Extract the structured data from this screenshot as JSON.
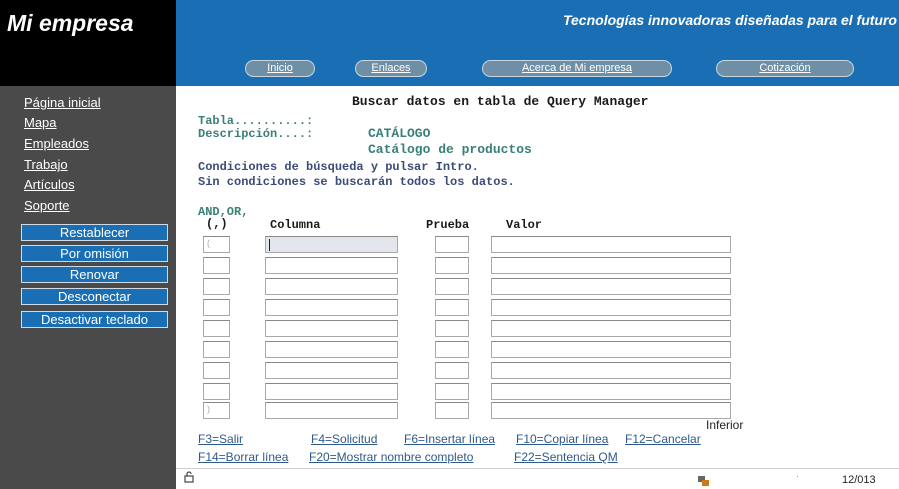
{
  "header": {
    "brand": "Mi empresa",
    "tagline": "Tecnologías innovadoras diseñadas para el futuro",
    "nav": [
      "Inicio",
      "Enlaces",
      "Acerca de Mi empresa",
      "Cotización"
    ]
  },
  "sidebar": {
    "links": [
      "Página inicial",
      "Mapa",
      "Empleados",
      "Trabajo",
      "Artículos",
      "Soporte"
    ],
    "buttons": [
      "Restablecer",
      "Por omisión",
      "Renovar",
      "Desconectar",
      "Desactivar teclado"
    ]
  },
  "screen": {
    "title": "Buscar datos en tabla de Query Manager",
    "tabla_label": "Tabla..........:",
    "desc_label": "Descripción....:",
    "tabla_value": "CATÁLOGO",
    "desc_value": "Catálogo de productos",
    "instr1": "Condiciones de búsqueda y pulsar Intro.",
    "instr2": "Sin condiciones se buscarán todos los datos.",
    "col_andor": "AND,OR,",
    "col_paren": "(,)",
    "col_columna": "Columna",
    "col_prueba": "Prueba",
    "col_valor": "Valor",
    "first_paren": "(",
    "last_paren": ")",
    "more": "Inferior"
  },
  "fkeys": {
    "f3": "F3=Salir",
    "f4": "F4=Solicitud",
    "f6": "F6=Insertar línea",
    "f10": "F10=Copiar línea",
    "f12": "F12=Cancelar",
    "f14": "F14=Borrar línea",
    "f20": "F20=Mostrar nombre completo",
    "f22": "F22=Sentencia QM"
  },
  "status": {
    "code": "12/013",
    "lock_icon": "lock-icon",
    "system_icon": "system-request-icon"
  },
  "colors": {
    "header_blue": "#1a6fb4",
    "sidebar_gray": "#4a4a4a",
    "label_teal": "#3a8078",
    "label_navy": "#3b4c78",
    "fkey_blue": "#2e5a8a"
  }
}
